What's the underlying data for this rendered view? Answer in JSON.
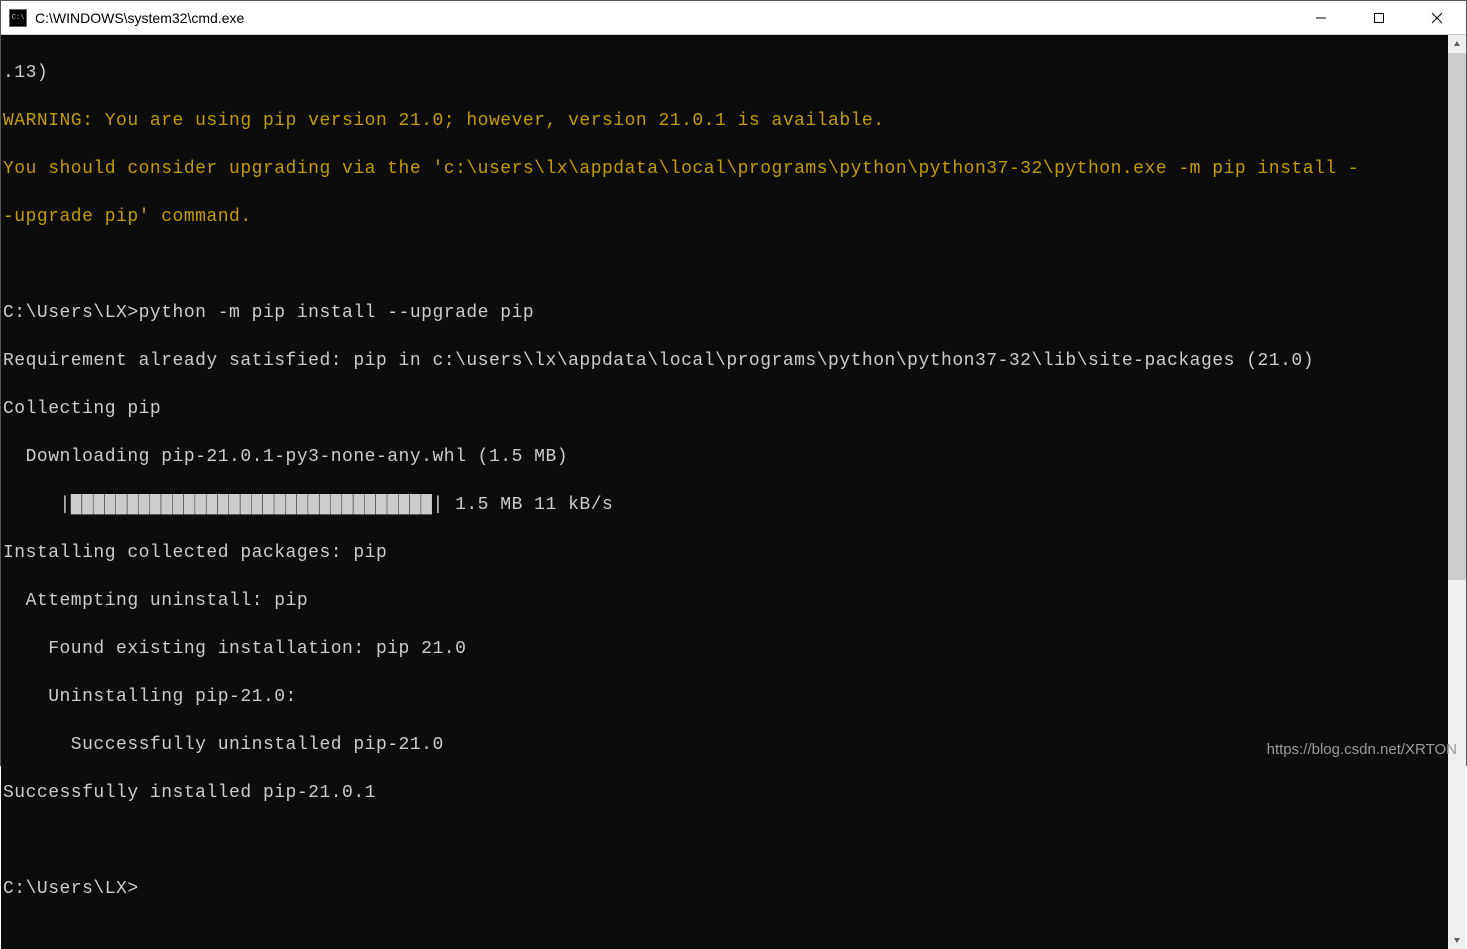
{
  "window": {
    "title": "C:\\WINDOWS\\system32\\cmd.exe"
  },
  "terminal": {
    "line1": ".13)",
    "warn1": "WARNING: You are using pip version 21.0; however, version 21.0.1 is available.",
    "warn2": "You should consider upgrading via the 'c:\\users\\lx\\appdata\\local\\programs\\python\\python37-32\\python.exe -m pip install -",
    "warn3": "-upgrade pip' command.",
    "blank1": " ",
    "prompt1": "C:\\Users\\LX>python -m pip install --upgrade pip",
    "req": "Requirement already satisfied: pip in c:\\users\\lx\\appdata\\local\\programs\\python\\python37-32\\lib\\site-packages (21.0)",
    "collect": "Collecting pip",
    "download": "  Downloading pip-21.0.1-py3-none-any.whl (1.5 MB)",
    "progress": "     |████████████████████████████████| 1.5 MB 11 kB/s",
    "install1": "Installing collected packages: pip",
    "install2": "  Attempting uninstall: pip",
    "install3": "    Found existing installation: pip 21.0",
    "install4": "    Uninstalling pip-21.0:",
    "install5": "      Successfully uninstalled pip-21.0",
    "install6": "Successfully installed pip-21.0.1",
    "blank2": " ",
    "prompt2": "C:\\Users\\LX>"
  },
  "watermark": "https://blog.csdn.net/XRTON"
}
